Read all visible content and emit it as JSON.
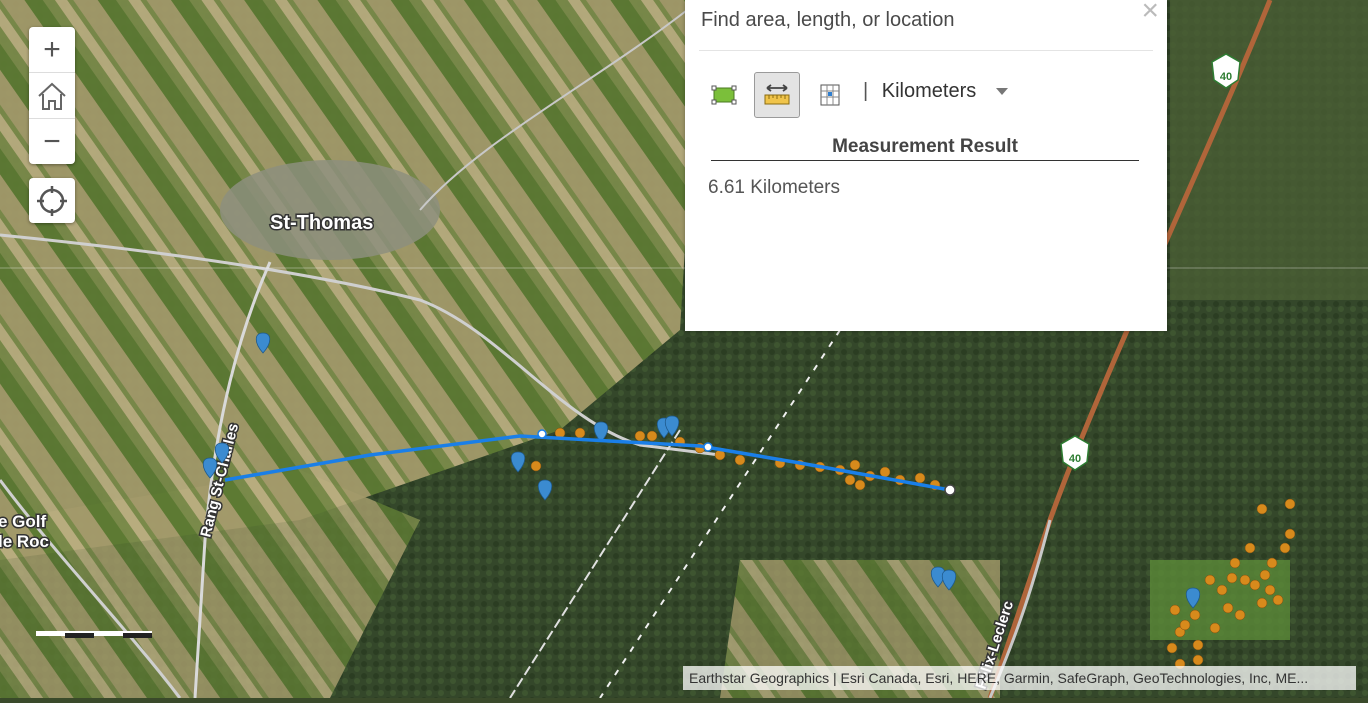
{
  "map": {
    "place_labels": {
      "town": "St-Thomas",
      "road_west": "Rang St-Charles",
      "road_east": "Félix-Leclerc",
      "golf_line1": "e Golf",
      "golf_line2": "le Roc",
      "highway_shield": "40"
    },
    "colors": {
      "measure_line": "#1a7fe8",
      "blue_marker": "#3b8bd0",
      "orange_point": "#d78a1c"
    }
  },
  "controls": {
    "zoom_in": "+",
    "zoom_out": "−"
  },
  "measure_panel": {
    "search_placeholder": "Find area, length, or location",
    "close_label": "×",
    "unit_separator": "|",
    "unit": "Kilometers",
    "result_heading": "Measurement Result",
    "result_value": "6.61 Kilometers",
    "active_tool": "distance"
  },
  "attribution": "Earthstar Geographics | Esri Canada, Esri, HERE, Garmin, SafeGraph, GeoTechnologies, Inc, ME..."
}
